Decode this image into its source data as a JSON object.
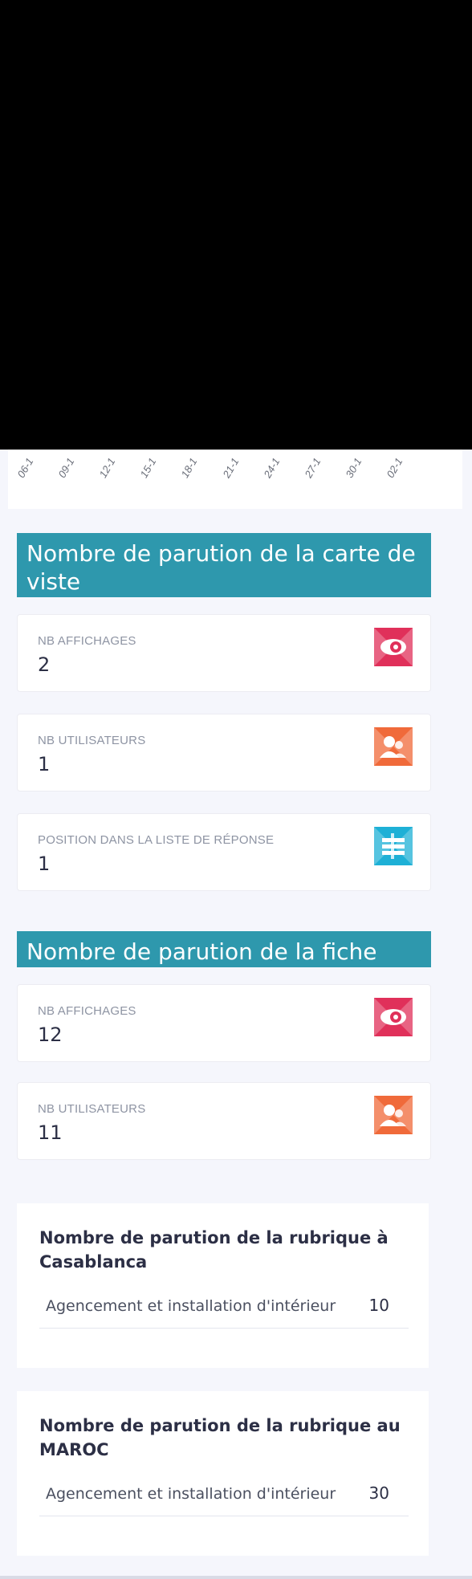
{
  "chart": {
    "x_ticks": [
      "06-1",
      "09-1",
      "12-1",
      "15-1",
      "18-1",
      "21-1",
      "24-1",
      "27-1",
      "30-1",
      "02-1"
    ]
  },
  "carte": {
    "title": "Nombre de parution de la carte de viste",
    "stats": [
      {
        "label": "NB AFFICHAGES",
        "value": "2",
        "icon": "eye-icon",
        "color": "#e0305a"
      },
      {
        "label": "NB UTILISATEURS",
        "value": "1",
        "icon": "users-icon",
        "color": "#f06a3a"
      },
      {
        "label": "POSITION DANS LA LISTE DE RÉPONSE",
        "value": "1",
        "icon": "list-icon",
        "color": "#1eb0d6"
      }
    ]
  },
  "fiche": {
    "title": "Nombre de parution de la fiche",
    "stats": [
      {
        "label": "NB AFFICHAGES",
        "value": "12",
        "icon": "eye-icon",
        "color": "#e0305a"
      },
      {
        "label": "NB UTILISATEURS",
        "value": "11",
        "icon": "users-icon",
        "color": "#f06a3a"
      }
    ]
  },
  "rubrique_casablanca": {
    "title": "Nombre de parution de la rubrique à Casablanca",
    "rows": [
      {
        "name": "Agencement et installation d'intérieur",
        "count": "10"
      }
    ]
  },
  "rubrique_maroc": {
    "title": "Nombre de parution de la rubrique au MAROC",
    "rows": [
      {
        "name": "Agencement et installation d'intérieur",
        "count": "30"
      }
    ]
  }
}
